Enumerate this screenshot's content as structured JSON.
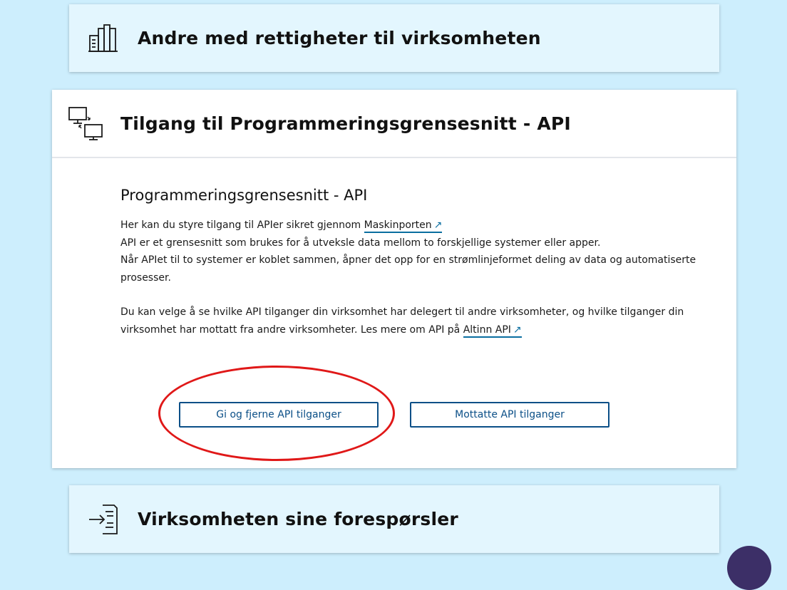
{
  "panels": {
    "rights": {
      "title": "Andre med rettigheter til virksomheten",
      "icon": "building-icon",
      "expanded": false
    },
    "api": {
      "title": "Tilgang til Programmeringsgrensesnitt - API",
      "icon": "computers-exchange-icon",
      "expanded": true,
      "subheading": "Programmeringsgrensesnitt - API",
      "intro_prefix": "Her kan du styre tilgang til APIer sikret gjennom ",
      "maskinporten_link": "Maskinporten",
      "line2": "API er et grensesnitt som brukes for å utveksle data mellom to forskjellige systemer eller apper.",
      "line3": "Når APIet til to systemer er koblet sammen, åpner det opp for en strømlinjeformet deling av data og automatiserte prosesser.",
      "para2_prefix": "Du kan velge å se hvilke API tilganger din virksomhet har delegert til andre virksomheter, og hvilke tilganger din virksomhet har mottatt fra andre virksomheter. Les mere om API på ",
      "altinn_api_link": "Altinn API",
      "button_give": "Gi og fjerne API tilganger",
      "button_received": "Mottatte API tilganger"
    },
    "requests": {
      "title": "Virksomheten sine forespørsler",
      "icon": "inbox-arrow-icon",
      "expanded": false
    }
  },
  "colors": {
    "page_background": "#cdeefd",
    "closed_panel": "#e3f6fe",
    "button_border": "#0b4f87",
    "link_underline": "#0a6ea0",
    "annotation": "#e01818",
    "floating_button": "#3c2f67"
  }
}
